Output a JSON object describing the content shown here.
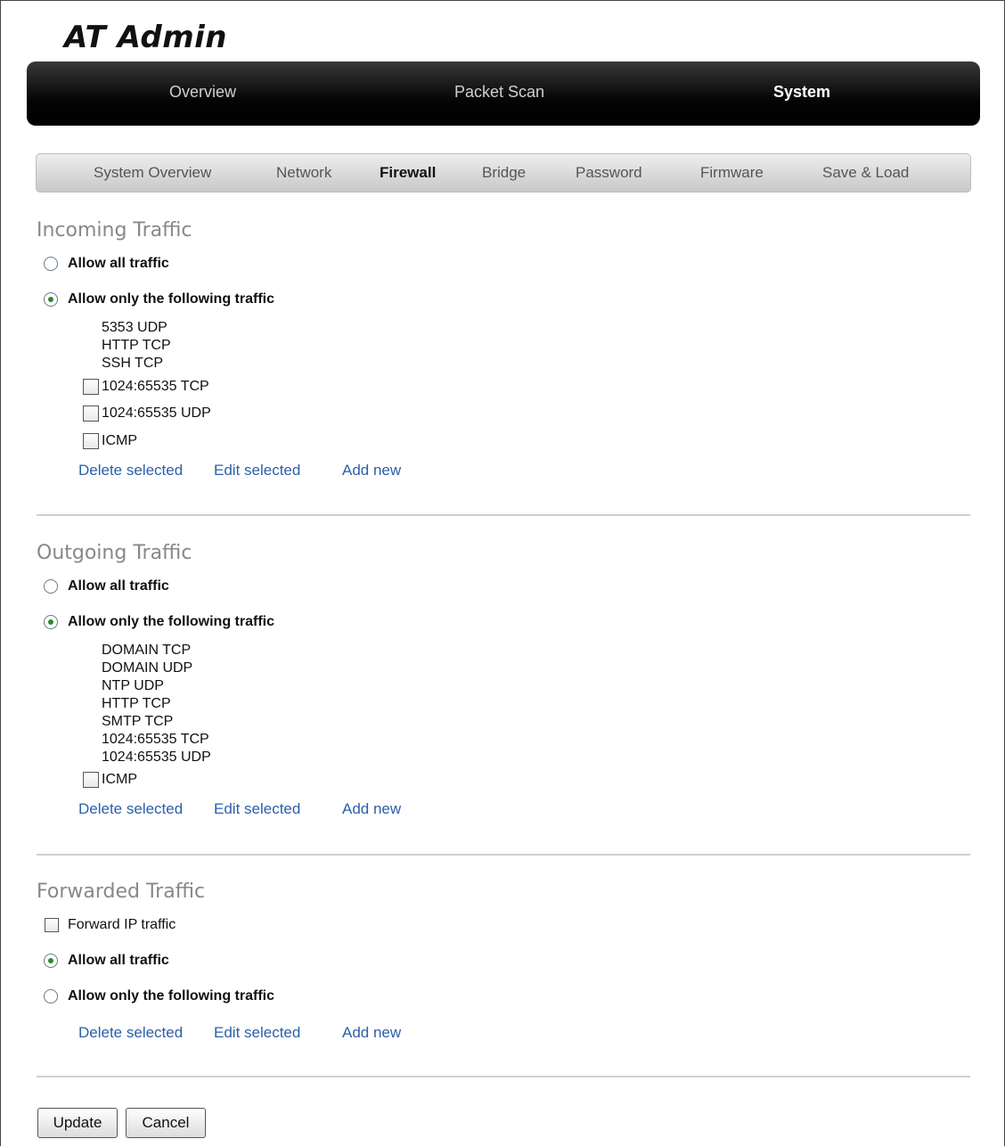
{
  "app": {
    "brand": "AT Admin"
  },
  "topnav": [
    {
      "label": "Overview",
      "active": false
    },
    {
      "label": "Packet Scan",
      "active": false
    },
    {
      "label": "System",
      "active": true
    }
  ],
  "subnav": [
    {
      "label": "System Overview",
      "active": false
    },
    {
      "label": "Network",
      "active": false
    },
    {
      "label": "Firewall",
      "active": true
    },
    {
      "label": "Bridge",
      "active": false
    },
    {
      "label": "Password",
      "active": false
    },
    {
      "label": "Firmware",
      "active": false
    },
    {
      "label": "Save & Load",
      "active": false
    }
  ],
  "incoming": {
    "title": "Incoming Traffic",
    "allow_all": {
      "label": "Allow all traffic",
      "checked": false
    },
    "allow_only": {
      "label": "Allow only the following traffic",
      "checked": true
    },
    "fixed_rules": [
      "5353 UDP",
      "HTTP TCP",
      "SSH TCP"
    ],
    "checkbox_rules": [
      "1024:65535 TCP",
      "1024:65535 UDP",
      "ICMP"
    ]
  },
  "outgoing": {
    "title": "Outgoing Traffic",
    "allow_all": {
      "label": "Allow all traffic",
      "checked": false
    },
    "allow_only": {
      "label": "Allow only the following traffic",
      "checked": true
    },
    "fixed_rules": [
      "DOMAIN TCP",
      "DOMAIN UDP",
      "NTP UDP",
      "HTTP TCP",
      "SMTP TCP",
      "1024:65535 TCP",
      "1024:65535 UDP"
    ],
    "checkbox_rules": [
      "ICMP"
    ]
  },
  "forwarded": {
    "title": "Forwarded Traffic",
    "forward_ip": {
      "label": "Forward IP traffic",
      "checked": false
    },
    "allow_all": {
      "label": "Allow all traffic",
      "checked": true
    },
    "allow_only": {
      "label": "Allow only the following traffic",
      "checked": false
    }
  },
  "actions": {
    "delete": "Delete selected",
    "edit": "Edit selected",
    "add": "Add new"
  },
  "buttons": {
    "update": "Update",
    "cancel": "Cancel"
  },
  "colors": {
    "link": "#2b5fa8",
    "radio_dot": "#2a8a2a",
    "section_title": "#888888"
  }
}
